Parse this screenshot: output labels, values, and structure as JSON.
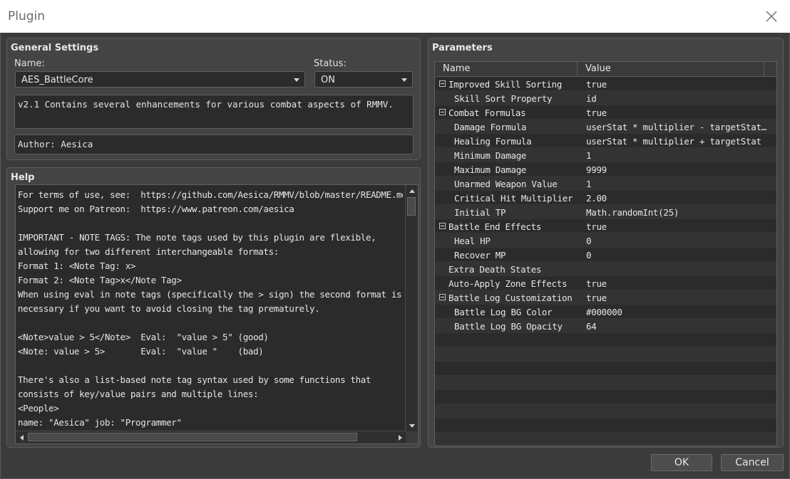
{
  "window": {
    "title": "Plugin"
  },
  "general": {
    "title": "General Settings",
    "name_label": "Name:",
    "name_value": "AES_BattleCore",
    "status_label": "Status:",
    "status_value": "ON",
    "description": "v2.1 Contains several enhancements for various combat aspects of RMMV.",
    "author": "Author: Aesica"
  },
  "help": {
    "title": "Help",
    "lines": [
      "For terms of use, see:  https://github.com/Aesica/RMMV/blob/master/README.md",
      "Support me on Patreon:  https://www.patreon.com/aesica",
      "",
      "IMPORTANT - NOTE TAGS: The note tags used by this plugin are flexible,",
      "allowing for two different interchangeable formats:",
      "Format 1: <Note Tag: x>",
      "Format 2: <Note Tag>x</Note Tag>",
      "When using eval in note tags (specifically the > sign) the second format is",
      "necessary if you want to avoid closing the tag prematurely.",
      "",
      "<Note>value > 5</Note>  Eval:  \"value > 5\" (good)",
      "<Note: value > 5>       Eval:  \"value \"    (bad)",
      "",
      "There's also a list-based note tag syntax used by some functions that",
      "consists of key/value pairs and multiple lines:",
      "<People>",
      "name: \"Aesica\" job: \"Programmer\""
    ]
  },
  "params": {
    "title": "Parameters",
    "col_name": "Name",
    "col_value": "Value",
    "rows": [
      {
        "name": "Improved Skill Sorting",
        "value": "true",
        "level": 0,
        "expander": true
      },
      {
        "name": "Skill Sort Property",
        "value": "id",
        "level": 1,
        "expander": false
      },
      {
        "name": "Combat Formulas",
        "value": "true",
        "level": 0,
        "expander": true
      },
      {
        "name": "Damage Formula",
        "value": "userStat * multiplier - targetStat…",
        "level": 1,
        "expander": false
      },
      {
        "name": "Healing Formula",
        "value": "userStat * multiplier + targetStat",
        "level": 1,
        "expander": false
      },
      {
        "name": "Minimum Damage",
        "value": "1",
        "level": 1,
        "expander": false
      },
      {
        "name": "Maximum Damage",
        "value": "9999",
        "level": 1,
        "expander": false
      },
      {
        "name": "Unarmed Weapon Value",
        "value": "1",
        "level": 1,
        "expander": false
      },
      {
        "name": "Critical Hit Multiplier",
        "value": "2.00",
        "level": 1,
        "expander": false
      },
      {
        "name": "Initial TP",
        "value": "Math.randomInt(25)",
        "level": 1,
        "expander": false
      },
      {
        "name": "Battle End Effects",
        "value": "true",
        "level": 0,
        "expander": true
      },
      {
        "name": "Heal HP",
        "value": "0",
        "level": 1,
        "expander": false
      },
      {
        "name": "Recover MP",
        "value": "0",
        "level": 1,
        "expander": false
      },
      {
        "name": "Extra Death States",
        "value": "",
        "level": 0,
        "expander": false
      },
      {
        "name": "Auto-Apply Zone Effects",
        "value": "true",
        "level": 0,
        "expander": false
      },
      {
        "name": "Battle Log Customization",
        "value": "true",
        "level": 0,
        "expander": true
      },
      {
        "name": "Battle Log BG Color",
        "value": "#000000",
        "level": 1,
        "expander": false
      },
      {
        "name": "Battle Log BG Opacity",
        "value": "64",
        "level": 1,
        "expander": false
      },
      {
        "name": "",
        "value": "",
        "level": 0,
        "expander": false
      },
      {
        "name": "",
        "value": "",
        "level": 0,
        "expander": false
      },
      {
        "name": "",
        "value": "",
        "level": 0,
        "expander": false
      },
      {
        "name": "",
        "value": "",
        "level": 0,
        "expander": false
      },
      {
        "name": "",
        "value": "",
        "level": 0,
        "expander": false
      },
      {
        "name": "",
        "value": "",
        "level": 0,
        "expander": false
      },
      {
        "name": "",
        "value": "",
        "level": 0,
        "expander": false
      },
      {
        "name": "",
        "value": "",
        "level": 0,
        "expander": false
      }
    ]
  },
  "buttons": {
    "ok": "OK",
    "cancel": "Cancel"
  }
}
